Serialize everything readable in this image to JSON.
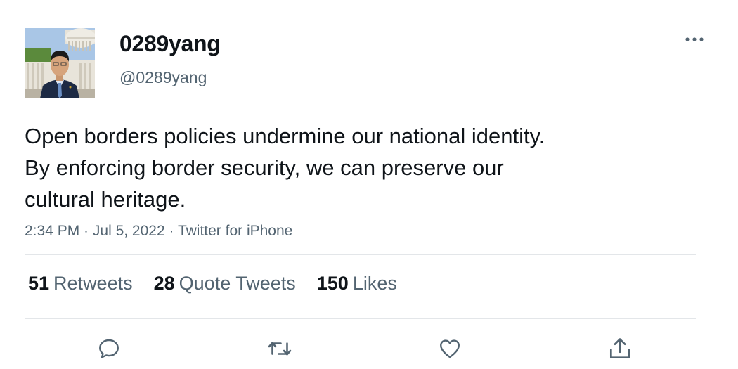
{
  "user": {
    "display_name": "0289yang",
    "handle": "@0289yang",
    "avatar_icon": "profile-photo-capitol"
  },
  "more_icon": "more-dots-icon",
  "tweet": {
    "lines": [
      "Open borders policies undermine our national identity.",
      "By enforcing border security, we can preserve our",
      "cultural heritage."
    ]
  },
  "meta": {
    "time": "2:34 PM",
    "date": "Jul 5, 2022",
    "source": "Twitter for iPhone",
    "separator": " · "
  },
  "stats": [
    {
      "count": "51",
      "label": "Retweets"
    },
    {
      "count": "28",
      "label": "Quote Tweets"
    },
    {
      "count": "150",
      "label": "Likes"
    }
  ],
  "actions": [
    {
      "icon": "reply-icon"
    },
    {
      "icon": "retweet-icon"
    },
    {
      "icon": "like-icon"
    },
    {
      "icon": "share-icon"
    }
  ],
  "colors": {
    "text": "#0f1419",
    "secondary": "#536471",
    "divider": "#e3e6e9"
  }
}
